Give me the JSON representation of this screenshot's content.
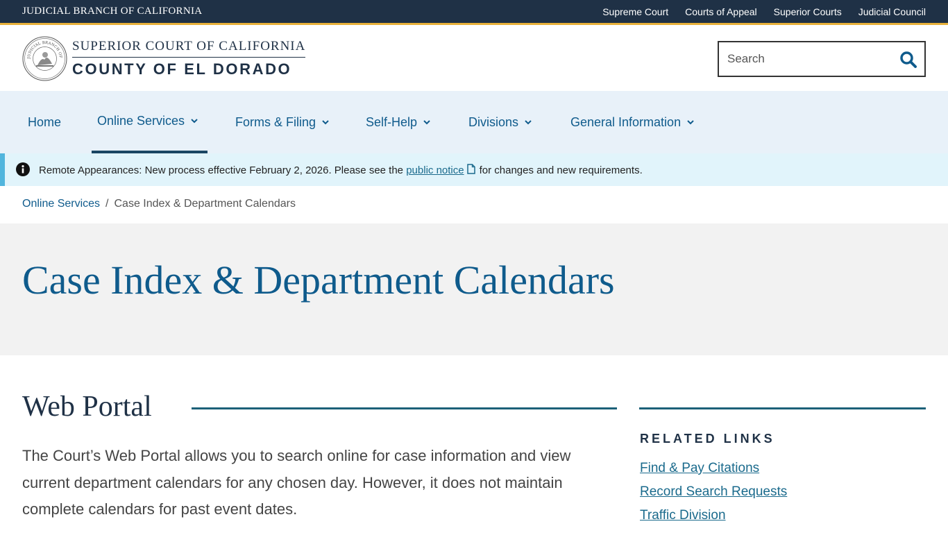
{
  "topbar": {
    "brand": "JUDICIAL BRANCH OF CALIFORNIA",
    "links": [
      "Supreme Court",
      "Courts of Appeal",
      "Superior Courts",
      "Judicial Council"
    ]
  },
  "header": {
    "seal_text": "JUDICIAL BRANCH OF CALIFORNIA",
    "line1": "SUPERIOR COURT OF CALIFORNIA",
    "line2": "COUNTY OF EL DORADO",
    "search_placeholder": "Search"
  },
  "nav": {
    "items": [
      {
        "label": "Home"
      },
      {
        "label": "Online Services"
      },
      {
        "label": "Forms & Filing"
      },
      {
        "label": "Self-Help"
      },
      {
        "label": "Divisions"
      },
      {
        "label": "General Information"
      }
    ]
  },
  "alert": {
    "text_before": "Remote Appearances: New process effective February 2, 2026. Please see the ",
    "link_label": "public notice",
    "text_after": "for changes and new requirements."
  },
  "breadcrumb": {
    "parent": "Online Services",
    "separator": "/",
    "current": "Case Index & Department Calendars"
  },
  "page": {
    "title": "Case Index & Department Calendars"
  },
  "main": {
    "section_title": "Web Portal",
    "body": "The Court’s Web Portal allows you to search online for case information and view current department calendars for any chosen day. However, it does not maintain complete calendars for past event dates."
  },
  "sidebar": {
    "title": "RELATED LINKS",
    "links": [
      "Find & Pay Citations",
      "Record Search Requests",
      "Traffic Division"
    ]
  },
  "colors": {
    "topbar": "#1f3146",
    "accent_gold": "#e8b13a",
    "link_blue": "#0f5b8c",
    "nav_bg": "#e8f1f9",
    "alert_bg": "#e1f4fb"
  }
}
